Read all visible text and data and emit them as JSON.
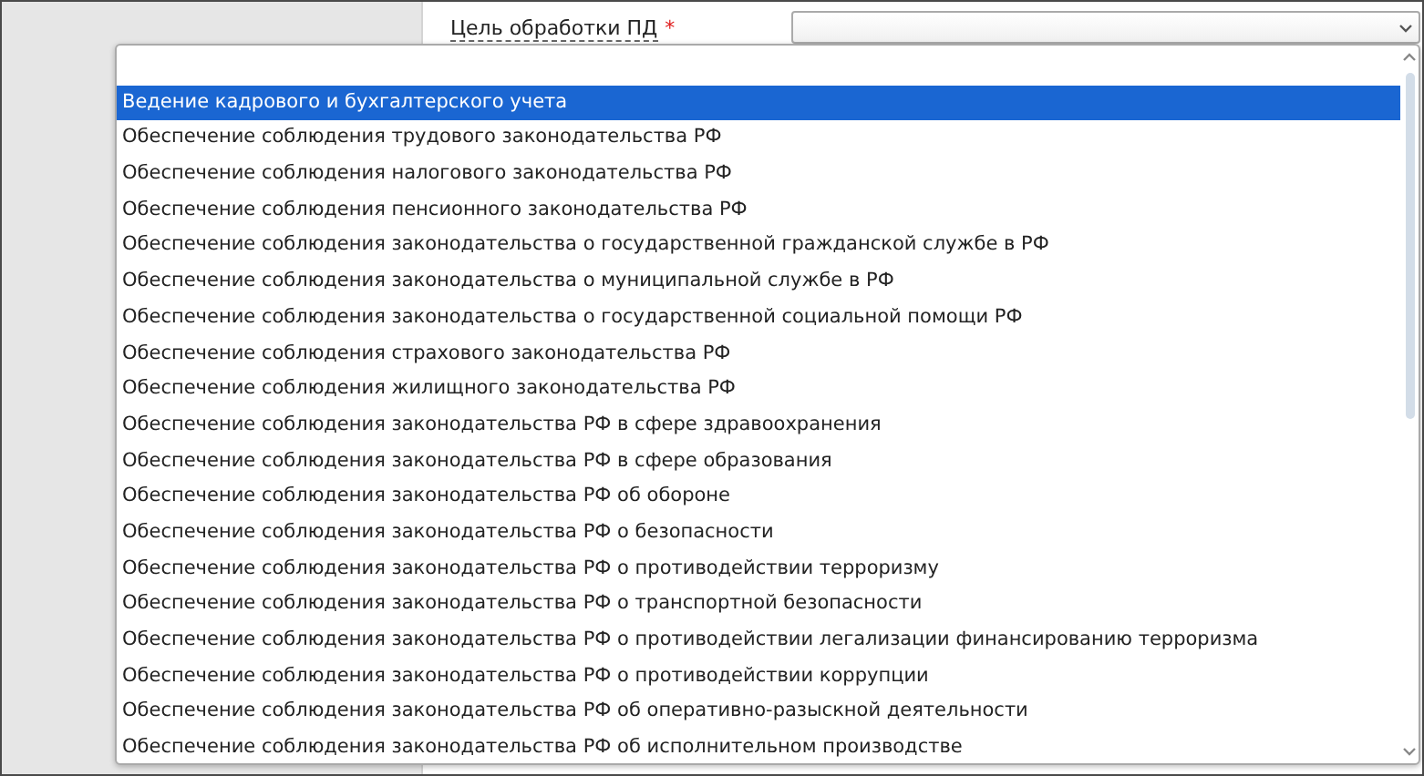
{
  "form": {
    "field_label": "Цель обработки ПД",
    "required_mark": "*"
  },
  "dropdown": {
    "has_blank_option": true,
    "options": [
      {
        "label": "Ведение кадрового и бухгалтерского учета",
        "selected": true
      },
      {
        "label": "Обеспечение соблюдения трудового законодательства РФ",
        "selected": false
      },
      {
        "label": "Обеспечение соблюдения налогового законодательства РФ",
        "selected": false
      },
      {
        "label": "Обеспечение соблюдения пенсионного законодательства РФ",
        "selected": false
      },
      {
        "label": "Обеспечение соблюдения законодательства о государственной гражданской службе в РФ",
        "selected": false
      },
      {
        "label": "Обеспечение соблюдения законодательства о муниципальной службе в РФ",
        "selected": false
      },
      {
        "label": "Обеспечение соблюдения законодательства о государственной социальной помощи РФ",
        "selected": false
      },
      {
        "label": "Обеспечение соблюдения страхового законодательства РФ",
        "selected": false
      },
      {
        "label": "Обеспечение соблюдения жилищного законодательства РФ",
        "selected": false
      },
      {
        "label": "Обеспечение соблюдения законодательства РФ в сфере здравоохранения",
        "selected": false
      },
      {
        "label": "Обеспечение соблюдения законодательства РФ в сфере образования",
        "selected": false
      },
      {
        "label": "Обеспечение соблюдения законодательства РФ об обороне",
        "selected": false
      },
      {
        "label": "Обеспечение соблюдения законодательства РФ о безопасности",
        "selected": false
      },
      {
        "label": "Обеспечение соблюдения законодательства РФ о противодействии терроризму",
        "selected": false
      },
      {
        "label": "Обеспечение соблюдения законодательства РФ о транспортной безопасности",
        "selected": false
      },
      {
        "label": "Обеспечение соблюдения законодательства РФ о противодействии легализации финансированию терроризма",
        "selected": false
      },
      {
        "label": "Обеспечение соблюдения законодательства РФ о противодействии коррупции",
        "selected": false
      },
      {
        "label": "Обеспечение соблюдения законодательства РФ об оперативно-разыскной деятельности",
        "selected": false
      },
      {
        "label": "Обеспечение соблюдения законодательства РФ об исполнительном производстве",
        "selected": false
      }
    ]
  }
}
